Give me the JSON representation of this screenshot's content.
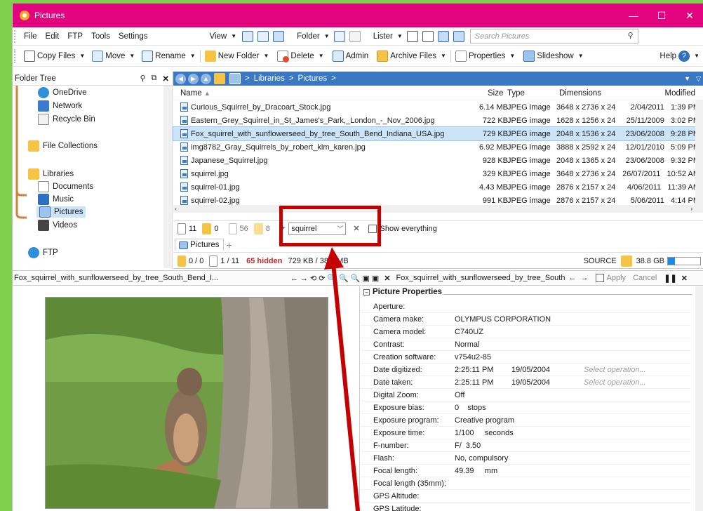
{
  "window": {
    "title": "Pictures",
    "accent": "#e2037e",
    "minimize": "—",
    "maximize": "☐",
    "close": "✕"
  },
  "menu": {
    "file": "File",
    "edit": "Edit",
    "ftp": "FTP",
    "tools": "Tools",
    "settings": "Settings",
    "view": "View",
    "folder": "Folder",
    "lister": "Lister",
    "search_placeholder": "Search Pictures"
  },
  "toolbar": {
    "copy": "Copy Files",
    "move": "Move",
    "rename": "Rename",
    "new_folder": "New Folder",
    "delete": "Delete",
    "admin": "Admin",
    "archive": "Archive Files",
    "properties": "Properties",
    "slideshow": "Slideshow",
    "help": "Help"
  },
  "folder_tree": {
    "header": "Folder Tree",
    "items": [
      {
        "label": "OneDrive",
        "icon": "cloud-icon"
      },
      {
        "label": "Network",
        "icon": "network-icon"
      },
      {
        "label": "Recycle Bin",
        "icon": "recycle-bin-icon"
      },
      {
        "label": "File Collections",
        "icon": "collections-icon"
      },
      {
        "label": "Libraries",
        "icon": "library-icon"
      },
      {
        "label": "Documents",
        "icon": "documents-icon"
      },
      {
        "label": "Music",
        "icon": "music-icon"
      },
      {
        "label": "Pictures",
        "icon": "pictures-icon"
      },
      {
        "label": "Videos",
        "icon": "videos-icon"
      },
      {
        "label": "FTP",
        "icon": "ftp-icon"
      }
    ]
  },
  "path": {
    "sep1": ">",
    "seg1": "Libraries",
    "sep2": ">",
    "seg2": "Pictures",
    "sep3": ">"
  },
  "columns": {
    "name": "Name",
    "size": "Size",
    "type": "Type",
    "dimensions": "Dimensions",
    "modified": "Modified"
  },
  "files": [
    {
      "name": "Curious_Squirrel_by_Dracoart_Stock.jpg",
      "size": "6.14 MB",
      "type": "JPEG image",
      "dim": "3648 x 2736 x 24",
      "date": "2/04/2011",
      "time": "1:39 PM"
    },
    {
      "name": "Eastern_Grey_Squirrel_in_St_James's_Park,_London_-_Nov_2006.jpg",
      "size": "722 KB",
      "type": "JPEG image",
      "dim": "1628 x 1256 x 24",
      "date": "25/11/2009",
      "time": "3:02 PM"
    },
    {
      "name": "Fox_squirrel_with_sunflowerseed_by_tree_South_Bend_Indiana_USA.jpg",
      "size": "729 KB",
      "type": "JPEG image",
      "dim": "2048 x 1536 x 24",
      "date": "23/06/2008",
      "time": "9:28 PM"
    },
    {
      "name": "img8782_Gray_Squirrels_by_robert_kim_karen.jpg",
      "size": "6.92 MB",
      "type": "JPEG image",
      "dim": "3888 x 2592 x 24",
      "date": "12/01/2010",
      "time": "5:09 PM"
    },
    {
      "name": "Japanese_Squirrel.jpg",
      "size": "928 KB",
      "type": "JPEG image",
      "dim": "2048 x 1365 x 24",
      "date": "23/06/2008",
      "time": "9:32 PM"
    },
    {
      "name": "squirrel.jpg",
      "size": "329 KB",
      "type": "JPEG image",
      "dim": "3648 x 2736 x 24",
      "date": "26/07/2011",
      "time": "10:52 AM"
    },
    {
      "name": "squirrel-01.jpg",
      "size": "4.43 MB",
      "type": "JPEG image",
      "dim": "2876 x 2157 x 24",
      "date": "4/06/2011",
      "time": "11:39 AM"
    },
    {
      "name": "squirrel-02.jpg",
      "size": "991 KB",
      "type": "JPEG image",
      "dim": "2876 x 2157 x 24",
      "date": "5/06/2011",
      "time": "4:14 PM"
    }
  ],
  "filter": {
    "files_count": "11",
    "folders_count": "0",
    "c56": "56",
    "c8": "8",
    "value": "squirrel",
    "show_everything": "Show everything"
  },
  "tabs": {
    "pictures": "Pictures",
    "add": "+"
  },
  "status": {
    "sel": "0 / 0",
    "files": "1 / 11",
    "hidden": "65 hidden",
    "size": "729 KB / 38.6 MB",
    "source": "SOURCE",
    "free": "38.8 GB"
  },
  "viewer": {
    "left_title": "Fox_squirrel_with_sunflowerseed_by_tree_South_Bend_I...",
    "right_title": "Fox_squirrel_with_sunflowerseed_by_tree_South_Bend_Indi...",
    "apply": "Apply",
    "cancel": "Cancel"
  },
  "properties": {
    "section": "Picture Properties",
    "rows": [
      {
        "k": "Aperture:",
        "v": "",
        "v2": "",
        "op": ""
      },
      {
        "k": "Camera make:",
        "v": "OLYMPUS CORPORATION",
        "v2": "",
        "op": ""
      },
      {
        "k": "Camera model:",
        "v": "C740UZ",
        "v2": "",
        "op": ""
      },
      {
        "k": "Contrast:",
        "v": "Normal",
        "v2": "",
        "op": ""
      },
      {
        "k": "Creation software:",
        "v": "v754u2-85",
        "v2": "",
        "op": ""
      },
      {
        "k": "Date digitized:",
        "v": "2:25:11 PM",
        "v2": "19/05/2004",
        "op": "Select operation..."
      },
      {
        "k": "Date taken:",
        "v": "2:25:11 PM",
        "v2": "19/05/2004",
        "op": "Select operation..."
      },
      {
        "k": "Digital Zoom:",
        "v": "Off",
        "v2": "",
        "op": ""
      },
      {
        "k": "Exposure bias:",
        "v": "0    stops",
        "v2": "",
        "op": ""
      },
      {
        "k": "Exposure program:",
        "v": "Creative program",
        "v2": "",
        "op": ""
      },
      {
        "k": "Exposure time:",
        "v": "1/100     seconds",
        "v2": "",
        "op": ""
      },
      {
        "k": "F-number:",
        "v": "F/  3.50",
        "v2": "",
        "op": ""
      },
      {
        "k": "Flash:",
        "v": "No, compulsory",
        "v2": "",
        "op": ""
      },
      {
        "k": "Focal length:",
        "v": "49.39     mm",
        "v2": "",
        "op": ""
      },
      {
        "k": "Focal length (35mm):",
        "v": "",
        "v2": "",
        "op": ""
      },
      {
        "k": "GPS Altitude:",
        "v": "",
        "v2": "",
        "op": ""
      },
      {
        "k": "GPS Latitude:",
        "v": "",
        "v2": "",
        "op": ""
      }
    ]
  }
}
